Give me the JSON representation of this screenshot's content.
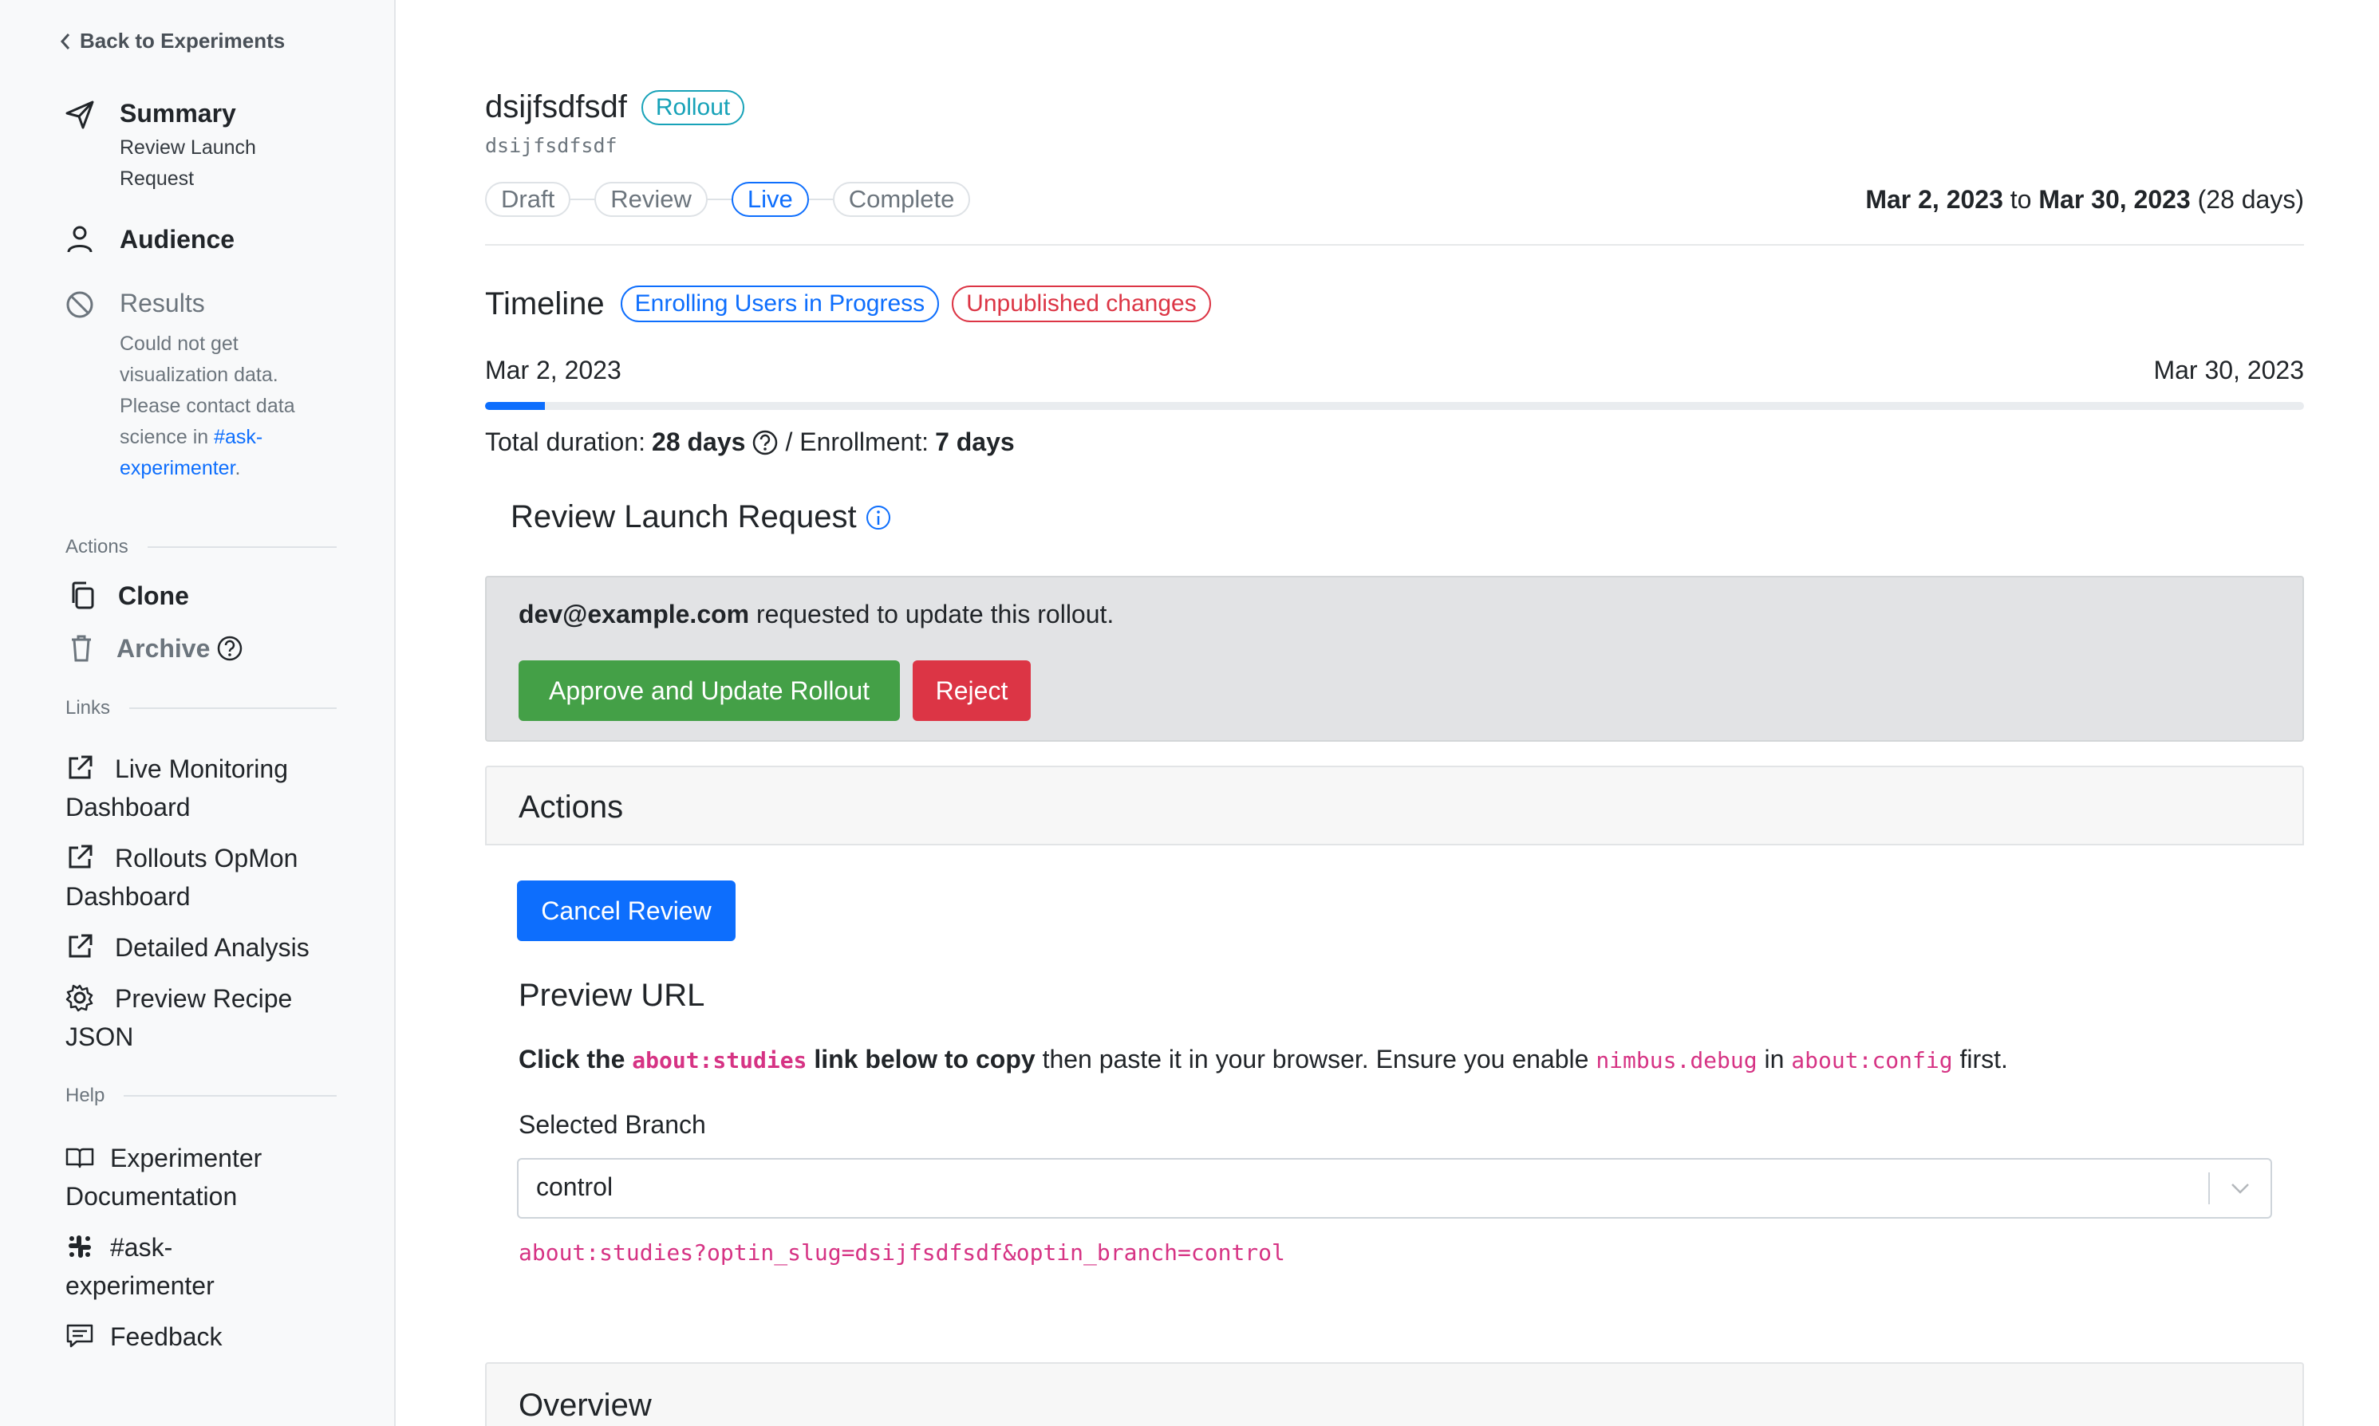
{
  "sidebar": {
    "back_label": "Back to Experiments",
    "nav": {
      "summary_title": "Summary",
      "summary_sub_1": "Review Launch",
      "summary_sub_2": "Request",
      "audience_title": "Audience",
      "results_title": "Results",
      "results_sub_1": "Could not get",
      "results_sub_2": "visualization data.",
      "results_sub_3": "Please contact data",
      "results_sub_4": "science in",
      "results_link_1": "#ask-",
      "results_link_2": "experimenter",
      "results_sub_end": "."
    },
    "actions_heading": "Actions",
    "clone_label": "Clone",
    "archive_label": "Archive",
    "links_heading": "Links",
    "links": {
      "live_monitoring_1": "Live Monitoring",
      "live_monitoring_2": "Dashboard",
      "rollouts_opmon_1": "Rollouts OpMon",
      "rollouts_opmon_2": "Dashboard",
      "detailed_analysis": "Detailed Analysis",
      "preview_recipe_1": "Preview Recipe",
      "preview_recipe_2": "JSON"
    },
    "help_heading": "Help",
    "help": {
      "docs_1": "Experimenter",
      "docs_2": "Documentation",
      "slack_1": "#ask-",
      "slack_2": "experimenter",
      "feedback": "Feedback"
    }
  },
  "header": {
    "name": "dsijfsdfsdf",
    "type_badge": "Rollout",
    "slug": "dsijfsdfsdf",
    "statuses": [
      "Draft",
      "Review",
      "Live",
      "Complete"
    ],
    "active_status": "Live",
    "start_date": "Mar 2, 2023",
    "date_sep": "to",
    "end_date": "Mar 30, 2023",
    "days_text": "(28 days)"
  },
  "timeline": {
    "title": "Timeline",
    "enrolling_badge": "Enrolling Users in Progress",
    "unpublished_badge": "Unpublished changes",
    "start": "Mar 2, 2023",
    "end": "Mar 30, 2023",
    "progress_fraction": 0.033,
    "duration_label": "Total duration:",
    "duration_value": "28 days",
    "enrollment_label": "/ Enrollment:",
    "enrollment_value": "7 days"
  },
  "review": {
    "title": "Review Launch Request",
    "requester": "dev@example.com",
    "message": "requested to update this rollout.",
    "approve_label": "Approve and Update Rollout",
    "reject_label": "Reject"
  },
  "actions_card": {
    "title": "Actions",
    "cancel_label": "Cancel Review"
  },
  "preview": {
    "title": "Preview URL",
    "desc_bold_1": "Click the",
    "desc_code_1": "about:studies",
    "desc_bold_2": "link below to copy",
    "desc_text_1": "then paste it in your browser. Ensure you enable",
    "desc_code_2": "nimbus.debug",
    "desc_text_2": "in",
    "desc_code_3": "about:config",
    "desc_text_3": "first.",
    "branch_label": "Selected Branch",
    "branch_value": "control",
    "url": "about:studies?optin_slug=dsijfsdfsdf&optin_branch=control"
  },
  "overview_card": {
    "title": "Overview"
  },
  "colors": {
    "primary": "#0d6efd",
    "success": "#44a047",
    "danger": "#dc3545",
    "teal": "#17a2b8",
    "code": "#d63384"
  }
}
